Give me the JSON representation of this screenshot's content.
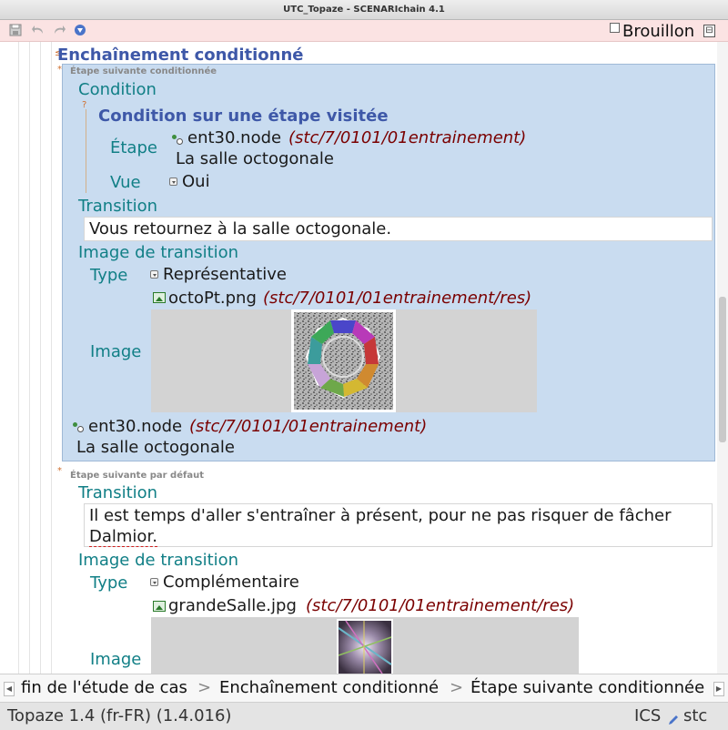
{
  "window": {
    "title": "UTC_Topaze - SCENARIchain 4.1"
  },
  "toolbar": {
    "icons": [
      "save-icon",
      "undo-icon",
      "redo-icon",
      "navigate-icon"
    ],
    "draft_label": "Brouillon"
  },
  "editor": {
    "title": "Enchaînement conditionné",
    "next_step_conditioned": {
      "header": "Étape suivante conditionnée",
      "condition_label": "Condition",
      "condition_title": "Condition sur une étape visitée",
      "etape_label": "Étape",
      "etape_node": "ent30.node",
      "etape_path": "(stc/7/0101/01entrainement)",
      "etape_desc": "La salle octogonale",
      "vue_label": "Vue",
      "vue_value": "Oui",
      "transition_label": "Transition",
      "transition_text": "Vous retournez à la salle octogonale.",
      "transition_image_label": "Image de transition",
      "type_label": "Type",
      "type_value": "Représentative",
      "image_label": "Image",
      "image_file": "octoPt.png",
      "image_path": "(stc/7/0101/01entrainement/res)",
      "target_node": "ent30.node",
      "target_path": "(stc/7/0101/01entrainement)",
      "target_desc": "La salle octogonale"
    },
    "default_next_step": {
      "header": "Étape suivante par défaut",
      "transition_label": "Transition",
      "transition_text_line1": "Il est temps d'aller s'entraîner à présent, pour ne pas risquer de fâcher",
      "transition_text_line2": "Dalmior.",
      "transition_image_label": "Image de transition",
      "type_label": "Type",
      "type_value": "Complémentaire",
      "image_label": "Image",
      "image_file": "grandeSalle.jpg",
      "image_path": "(stc/7/0101/01entrainement/res)"
    }
  },
  "breadcrumb": {
    "items": [
      "fin de l'étude de cas",
      "Enchaînement conditionné",
      "Étape suivante conditionnée"
    ],
    "separator": ">"
  },
  "status": {
    "left": "Topaze 1.4 (fr-FR) (1.4.016)",
    "ics": "ICS",
    "user": "stc"
  }
}
